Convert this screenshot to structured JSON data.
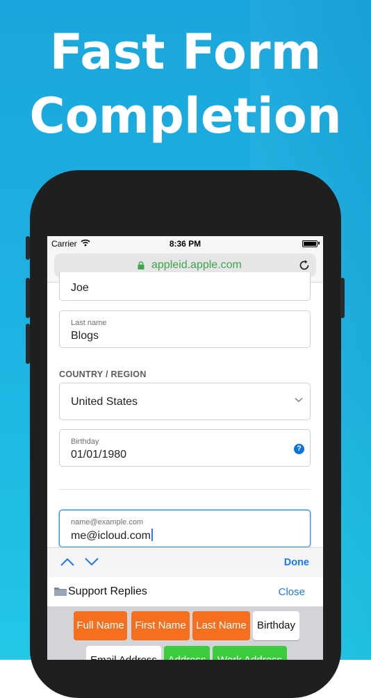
{
  "headline": {
    "line1": "Fast Form",
    "line2": "Completion"
  },
  "status_bar": {
    "carrier": "Carrier",
    "time": "8:36 PM"
  },
  "browser": {
    "url": "appleid.apple.com"
  },
  "form": {
    "first_name_value": "Joe",
    "last_name_label": "Last name",
    "last_name_value": "Blogs",
    "country_section": "COUNTRY / REGION",
    "country_value": "United States",
    "birthday_label": "Birthday",
    "birthday_value": "01/01/1980",
    "help_glyph": "?",
    "email_placeholder": "name@example.com",
    "email_value": "me@icloud.com"
  },
  "accessory_bar": {
    "done_label": "Done"
  },
  "replies": {
    "title": "Support Replies",
    "close_label": "Close"
  },
  "reply_keys": [
    {
      "label": "Full Name",
      "color": "#f4701e"
    },
    {
      "label": "First Name",
      "color": "#f4701e"
    },
    {
      "label": "Last Name",
      "color": "#f4701e"
    },
    {
      "label": "Birthday",
      "color": "#ffffff"
    },
    {
      "label": "Email Address",
      "color": "#ffffff"
    },
    {
      "label": "Address",
      "color": "#3ccb3c"
    },
    {
      "label": "Work Address",
      "color": "#3ccb3c"
    }
  ],
  "colors": {
    "background": "#1eb4e3",
    "link": "#1a7ae6",
    "url": "#3aa648",
    "focus": "#3a8de0"
  }
}
